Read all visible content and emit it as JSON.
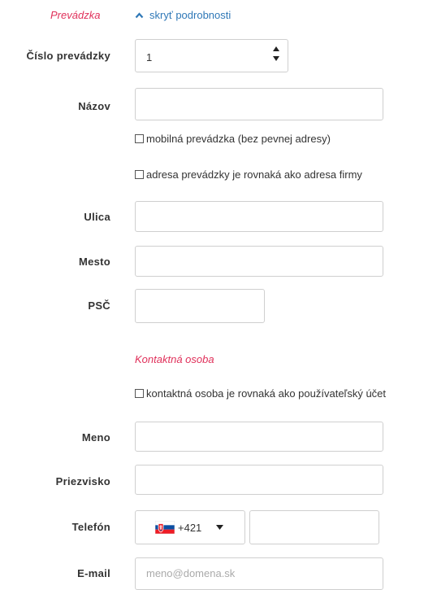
{
  "store_section": {
    "title": "Prevádzka",
    "toggle_label": "skryť podrobnosti"
  },
  "store_number": {
    "label": "Číslo prevádzky",
    "value": "1"
  },
  "store_name": {
    "label": "Názov",
    "value": ""
  },
  "checkboxes": {
    "mobile": "mobilná prevádzka (bez pevnej adresy)",
    "same_address": "adresa prevádzky je rovnaká ako adresa firmy",
    "same_contact": "kontaktná osoba je rovnaká ako používateľský účet"
  },
  "address": {
    "street_label": "Ulica",
    "city_label": "Mesto",
    "zip_label": "PSČ"
  },
  "contact_section": {
    "title": "Kontaktná osoba"
  },
  "contact": {
    "first_name_label": "Meno",
    "last_name_label": "Priezvisko",
    "phone_label": "Telefón",
    "phone_prefix": "+421",
    "email_label": "E-mail",
    "email_placeholder": "meno@domena.sk"
  },
  "icons": {
    "toggle": "chevron-up-icon",
    "stepper_up": "triangle-up-icon",
    "stepper_down": "triangle-down-icon",
    "flag": "slovakia-flag-icon",
    "dropdown": "caret-down-icon"
  },
  "colors": {
    "section_title": "#e0305a",
    "link": "#2f78b7",
    "border": "#cfcfcf"
  }
}
